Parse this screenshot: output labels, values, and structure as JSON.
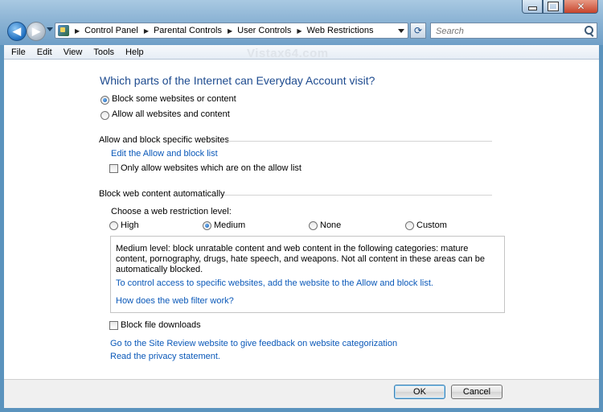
{
  "window": {
    "caption_buttons": {
      "minimize": "minimize-icon",
      "maximize": "maximize-icon",
      "close": "close-icon"
    }
  },
  "nav": {
    "breadcrumbs": [
      "Control Panel",
      "Parental Controls",
      "User Controls",
      "Web Restrictions"
    ],
    "search_placeholder": "Search"
  },
  "menu": [
    "File",
    "Edit",
    "View",
    "Tools",
    "Help"
  ],
  "watermark": "Vistax64.com",
  "main": {
    "title": "Which parts of the Internet can Everyday Account visit?",
    "scope_options": [
      {
        "label": "Block some websites or content",
        "selected": true
      },
      {
        "label": "Allow all websites and content",
        "selected": false
      }
    ],
    "allow_block": {
      "heading": "Allow and block specific websites",
      "edit_link": "Edit the Allow and block list",
      "only_allow_label": "Only allow websites which are on the allow list",
      "only_allow_checked": false
    },
    "auto_block": {
      "heading": "Block web content automatically",
      "choose_label": "Choose a web restriction level:",
      "levels": [
        {
          "label": "High",
          "selected": false
        },
        {
          "label": "Medium",
          "selected": true
        },
        {
          "label": "None",
          "selected": false
        },
        {
          "label": "Custom",
          "selected": false
        }
      ],
      "description": "Medium level:  block unratable content and web content in the following categories:  mature content, pornography, drugs, hate speech, and weapons.  Not all content in these areas can be automatically blocked.",
      "control_access_link": "To control access to specific websites, add the website to the Allow and block list.",
      "how_link": "How does the web filter work?"
    },
    "block_downloads_label": "Block file downloads",
    "block_downloads_checked": false,
    "site_review_link": "Go to the Site Review website to give feedback on website categorization",
    "privacy_link": "Read the privacy statement."
  },
  "footer": {
    "ok": "OK",
    "cancel": "Cancel"
  }
}
